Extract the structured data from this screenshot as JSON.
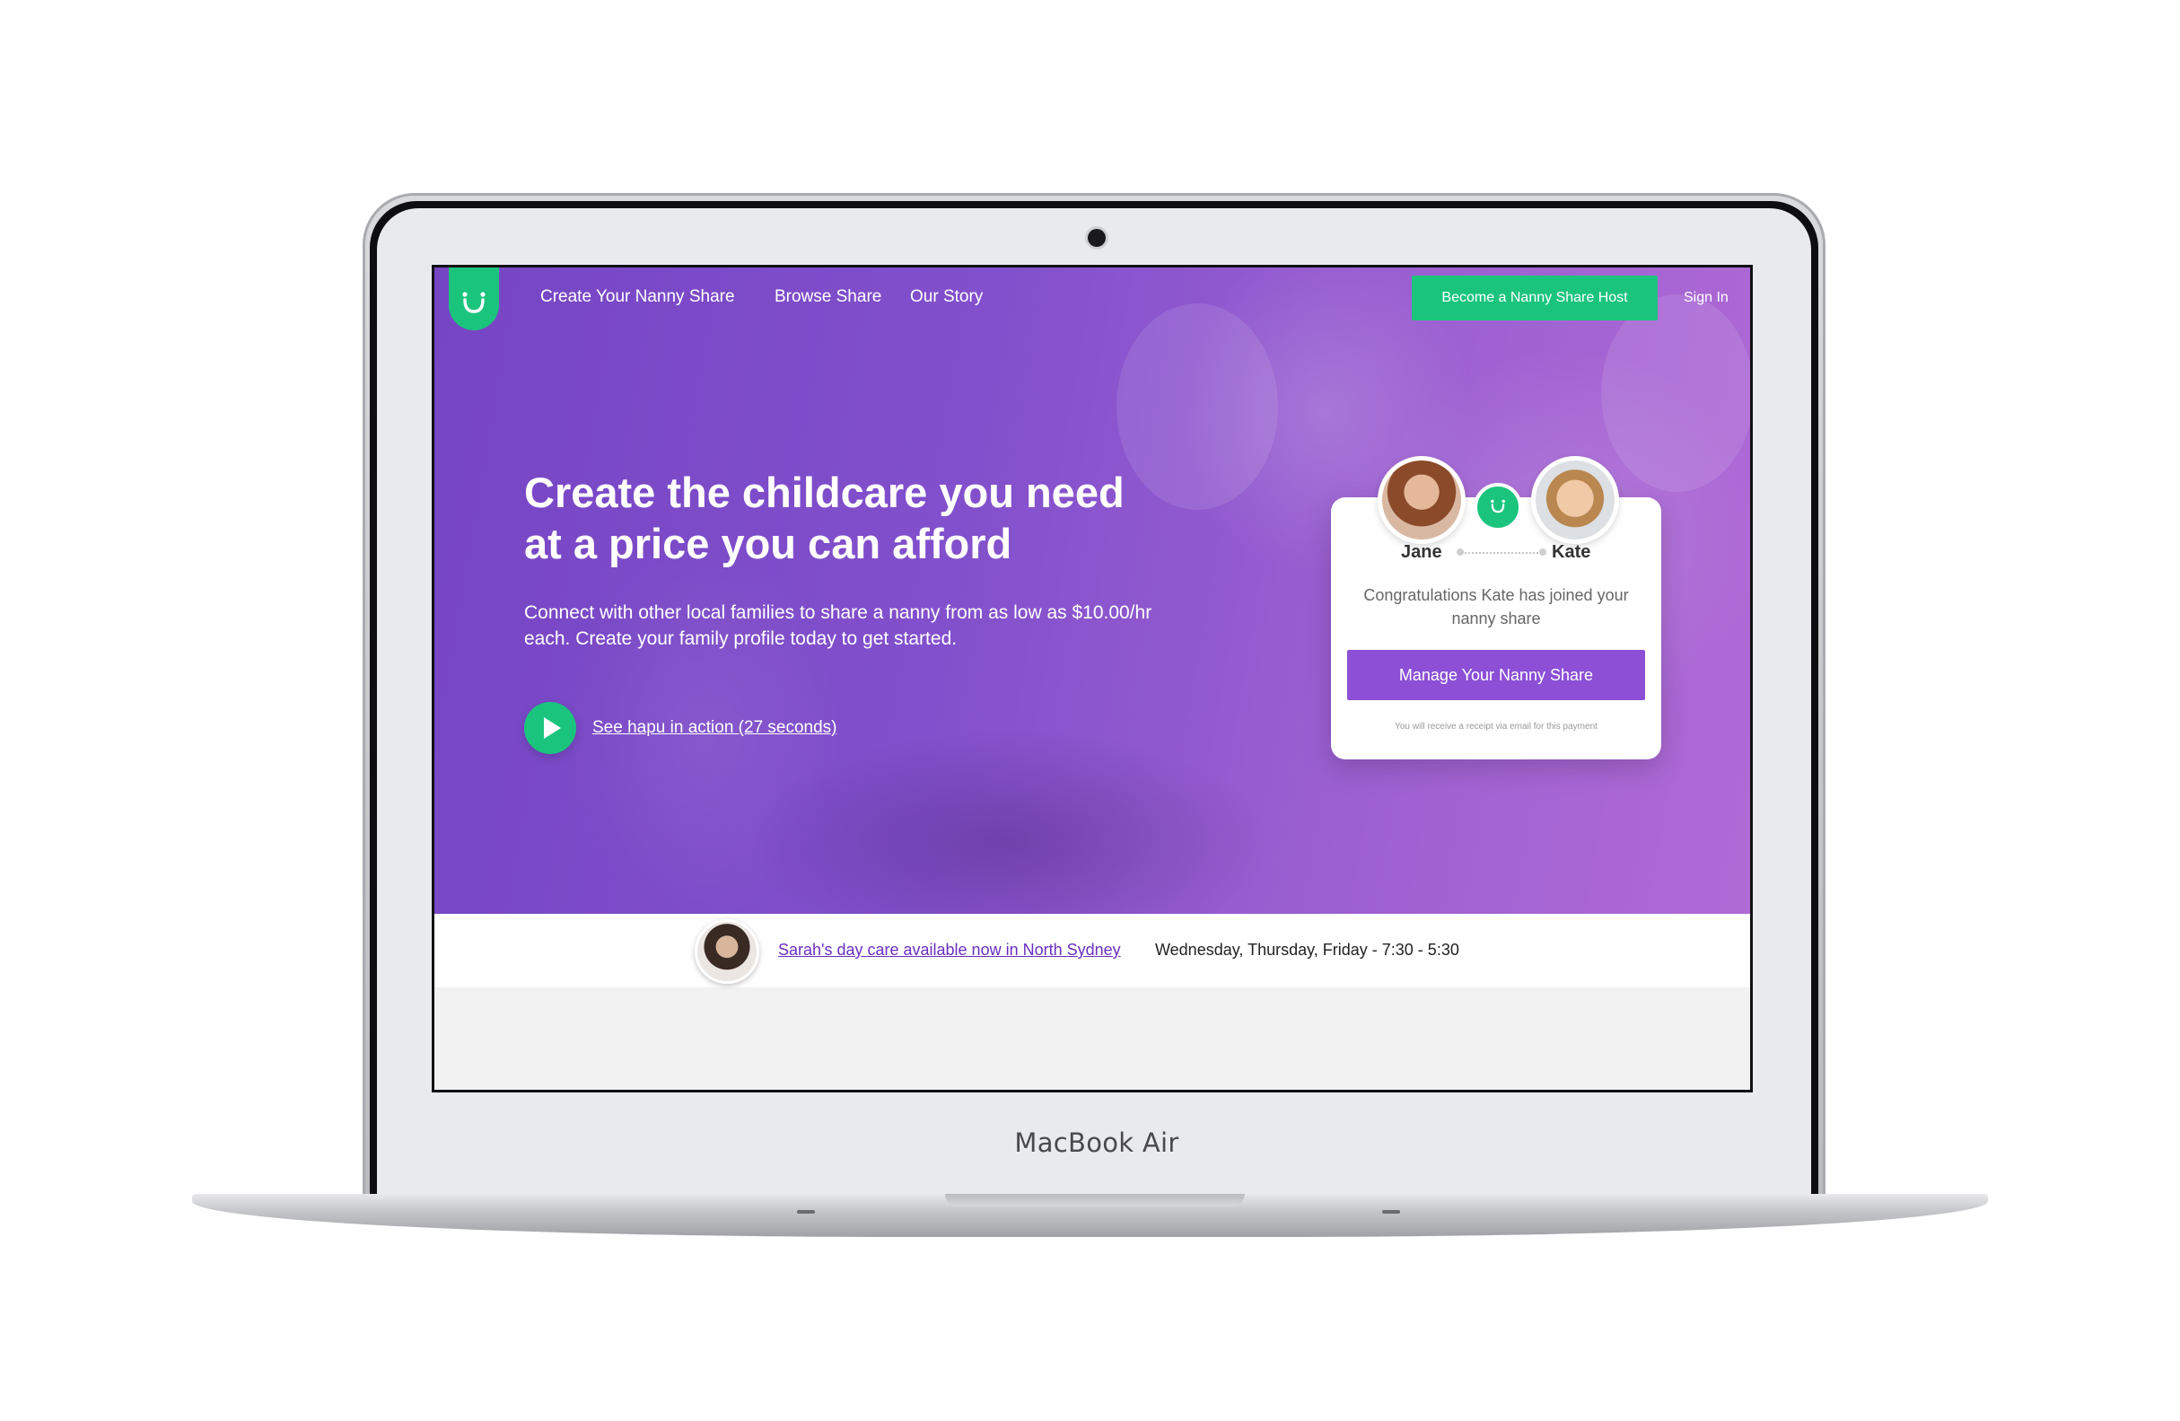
{
  "device": {
    "label": "MacBook Air"
  },
  "nav": {
    "links": [
      "Create Your Nanny Share",
      "Browse Share",
      "Our Story"
    ],
    "host_button": "Become a Nanny Share Host",
    "sign_in": "Sign In"
  },
  "hero": {
    "headline": "Create the childcare you need at a price you can afford",
    "subtext": "Connect with other local families to share a nanny from as low as $10.00/hr each. Create your family profile today to get started.",
    "video_link": "See hapu in action (27 seconds)"
  },
  "card": {
    "name_left": "Jane",
    "name_right": "Kate",
    "message": "Congratulations Kate has joined your nanny share",
    "button": "Manage Your Nanny Share",
    "note": "You will receive a receipt via email for this payment"
  },
  "banner": {
    "link": "Sarah's day care available now in North Sydney",
    "schedule": "Wednesday, Thursday, Friday - 7:30 - 5:30"
  },
  "colors": {
    "purple": "#8250cc",
    "green": "#1bc47d",
    "button_purple": "#8c4fd6",
    "link_purple": "#6a2fc0"
  },
  "icons": [
    "hapu-logo-icon",
    "play-icon",
    "avatar-jane",
    "avatar-kate",
    "avatar-sarah"
  ]
}
